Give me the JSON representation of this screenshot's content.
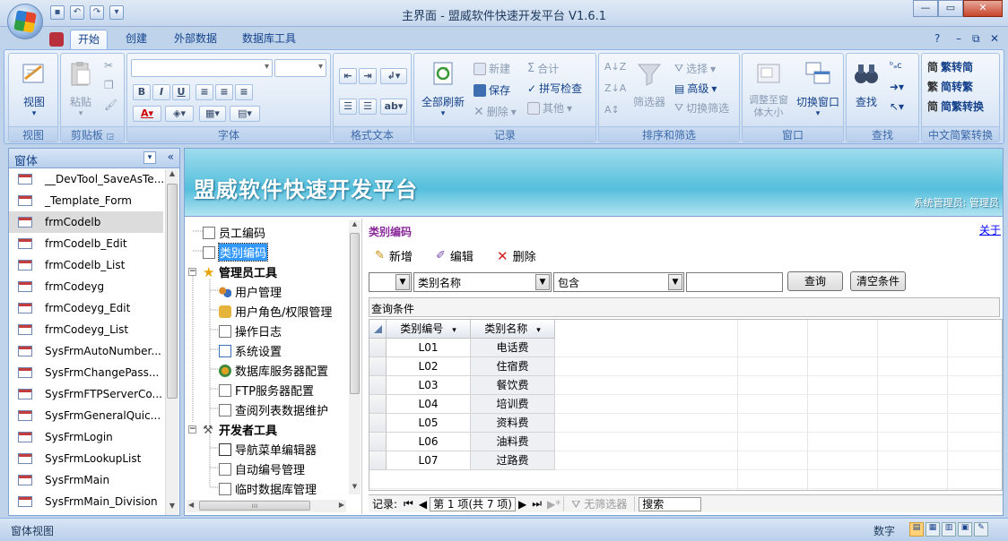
{
  "window": {
    "title": "主界面 - 盟威软件快速开发平台 V1.6.1"
  },
  "ribbon": {
    "tabs": [
      "开始",
      "创建",
      "外部数据",
      "数据库工具"
    ],
    "active_tab": "开始",
    "groups": {
      "view": {
        "label": "视图",
        "view_btn": "视图"
      },
      "clipboard": {
        "label": "剪贴板",
        "paste": "粘贴"
      },
      "font": {
        "label": "字体"
      },
      "richtext": {
        "label": "格式文本"
      },
      "records": {
        "label": "记录",
        "refresh": "全部刷新",
        "new": "新建",
        "save": "保存",
        "delete": "删除",
        "total": "合计",
        "spell": "拼写检查",
        "other": "其他"
      },
      "sort": {
        "label": "排序和筛选",
        "filter": "筛选器",
        "selection": "选择",
        "advanced": "高级",
        "toggle": "切换筛选"
      },
      "window": {
        "label": "窗口",
        "resize": "调整至窗体大小",
        "switch": "切换窗口"
      },
      "find": {
        "label": "查找",
        "find": "查找"
      },
      "chinese": {
        "label": "中文简繁转换",
        "t2s": "繁转简",
        "s2t": "简转繁",
        "convert": "简繁转换"
      }
    }
  },
  "nav": {
    "header": "窗体",
    "items": [
      "__DevTool_SaveAsTe...",
      "_Template_Form",
      "frmCodelb",
      "frmCodelb_Edit",
      "frmCodelb_List",
      "frmCodeyg",
      "frmCodeyg_Edit",
      "frmCodeyg_List",
      "SysFrmAutoNumber...",
      "SysFrmChangePass...",
      "SysFrmFTPServerCo...",
      "SysFrmGeneralQuic...",
      "SysFrmLogin",
      "SysFrmLookupList",
      "SysFrmMain",
      "SysFrmMain_Division"
    ],
    "selected_index": 2
  },
  "banner": {
    "title": "盟威软件快速开发平台",
    "user": "系统管理员: 管理员"
  },
  "tree": {
    "n0": "员工编码",
    "n1": "类别编码",
    "n2": "管理员工具",
    "n3": "用户管理",
    "n4": "用户角色/权限管理",
    "n5": "操作日志",
    "n6": "系统设置",
    "n7": "数据库服务器配置",
    "n8": "FTP服务器配置",
    "n9": "查阅列表数据维护",
    "n10": "开发者工具",
    "n11": "导航菜单编辑器",
    "n12": "自动编号管理",
    "n13": "临时数据库管理"
  },
  "content": {
    "title": "类别编码",
    "close_link": "关于",
    "toolbar": {
      "new": "新增",
      "edit": "编辑",
      "delete": "删除"
    },
    "filter": {
      "field": "类别名称",
      "op": "包含",
      "value": "",
      "query_btn": "查询",
      "clear_btn": "清空条件",
      "conditions_label": "查询条件"
    },
    "grid": {
      "columns": [
        "类别编号",
        "类别名称"
      ],
      "rows": [
        [
          "L01",
          "电话费"
        ],
        [
          "L02",
          "住宿费"
        ],
        [
          "L03",
          "餐饮费"
        ],
        [
          "L04",
          "培训费"
        ],
        [
          "L05",
          "资料费"
        ],
        [
          "L06",
          "油料费"
        ],
        [
          "L07",
          "过路费"
        ]
      ]
    },
    "recnav": {
      "label": "记录:",
      "position": "第 1 项(共 7 项)",
      "filter": "无筛选器",
      "search": "搜索"
    }
  },
  "status": {
    "left": "窗体视图",
    "mode": "数字"
  },
  "colors": {
    "banner": "#55bfdc",
    "ribbon": "#d5e3f4",
    "selection": "#3399ff"
  }
}
